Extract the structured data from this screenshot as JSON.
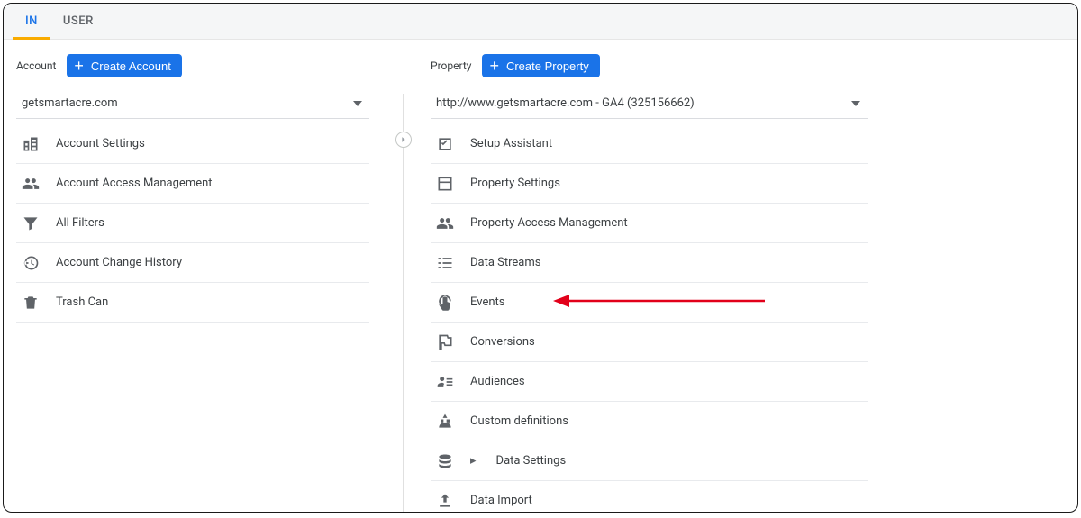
{
  "tabs": {
    "admin": "IN",
    "user": "USER"
  },
  "account": {
    "section_label": "Account",
    "create_button": "Create Account",
    "selected": "getsmartacre.com",
    "items": [
      {
        "label": "Account Settings"
      },
      {
        "label": "Account Access Management"
      },
      {
        "label": "All Filters"
      },
      {
        "label": "Account Change History"
      },
      {
        "label": "Trash Can"
      }
    ]
  },
  "property": {
    "section_label": "Property",
    "create_button": "Create Property",
    "selected": "http://www.getsmartacre.com - GA4 (325156662)",
    "items": [
      {
        "label": "Setup Assistant"
      },
      {
        "label": "Property Settings"
      },
      {
        "label": "Property Access Management"
      },
      {
        "label": "Data Streams"
      },
      {
        "label": "Events"
      },
      {
        "label": "Conversions"
      },
      {
        "label": "Audiences"
      },
      {
        "label": "Custom definitions"
      },
      {
        "label": "Data Settings"
      },
      {
        "label": "Data Import"
      }
    ]
  }
}
